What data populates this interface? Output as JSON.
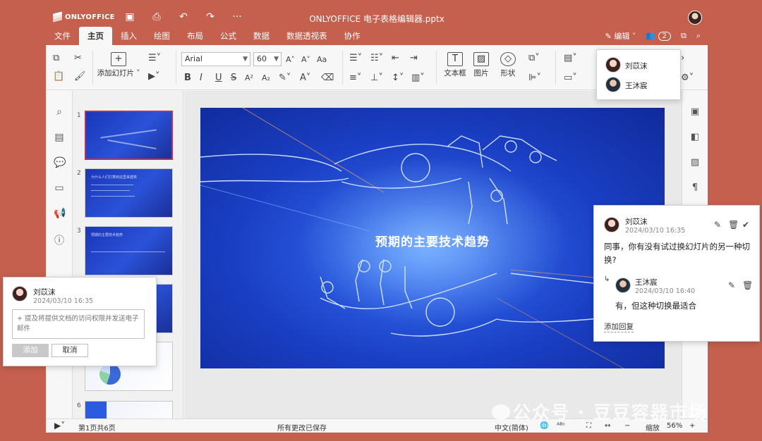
{
  "app": {
    "logo_text": "ONLYOFFICE",
    "doc_title": "ONLYOFFICE 电子表格编辑器.pptx",
    "title_icons": [
      "save-icon",
      "print-icon",
      "undo-icon",
      "redo-icon",
      "more-icon"
    ]
  },
  "menu": {
    "tabs": [
      "文件",
      "主页",
      "插入",
      "绘图",
      "布局",
      "公式",
      "数据",
      "数据透视表",
      "协作"
    ],
    "active_tab": "主页",
    "edit_label": "编辑",
    "users_count": "2"
  },
  "toolbar": {
    "add_slide_label": "添加幻灯片",
    "font_name": "Arial",
    "font_size": "60",
    "textbox_label": "文本框",
    "picture_label": "图片",
    "shape_label": "形状",
    "bold": "B",
    "italic": "I",
    "underline": "U",
    "strike": "S",
    "superscript": "A²",
    "subscript": "A₂",
    "grow_font": "A˄",
    "shrink_font": "A˅",
    "case": "Aa"
  },
  "users_popup": {
    "users": [
      {
        "name": "刘苡沫",
        "avatar": "female"
      },
      {
        "name": "王沐宸",
        "avatar": "male"
      }
    ]
  },
  "slides": {
    "numbers": [
      "1",
      "2",
      "3",
      "4",
      "5",
      "6"
    ],
    "slide2_title": "为什么人们打算到这里来建筑",
    "slide3_title": "预期的主要技术趋势",
    "main_title": "预期的主要技术趋势"
  },
  "comment_thread": {
    "author": "刘苡沫",
    "date": "2024/03/10  16:35",
    "text": "同事，你有没有试过换幻灯片的另一种切换?",
    "reply": {
      "author": "王沐宸",
      "date": "2024/03/10  16:40",
      "text": "有，但这种切换最适合"
    },
    "add_reply": "添加回复"
  },
  "new_comment": {
    "author": "刘苡沫",
    "date": "2024/03/10  16:35",
    "placeholder": "+ 提及将提供文档的访问权限并发送电子邮件",
    "add_label": "添加",
    "cancel_label": "取消"
  },
  "status": {
    "page_info": "第1页共6页",
    "save_status": "所有更改已保存",
    "language": "中文(简体)",
    "zoom_label": "缩放",
    "zoom_value": "56%"
  },
  "watermark": {
    "text": "公众号 · 豆豆容器市场"
  }
}
